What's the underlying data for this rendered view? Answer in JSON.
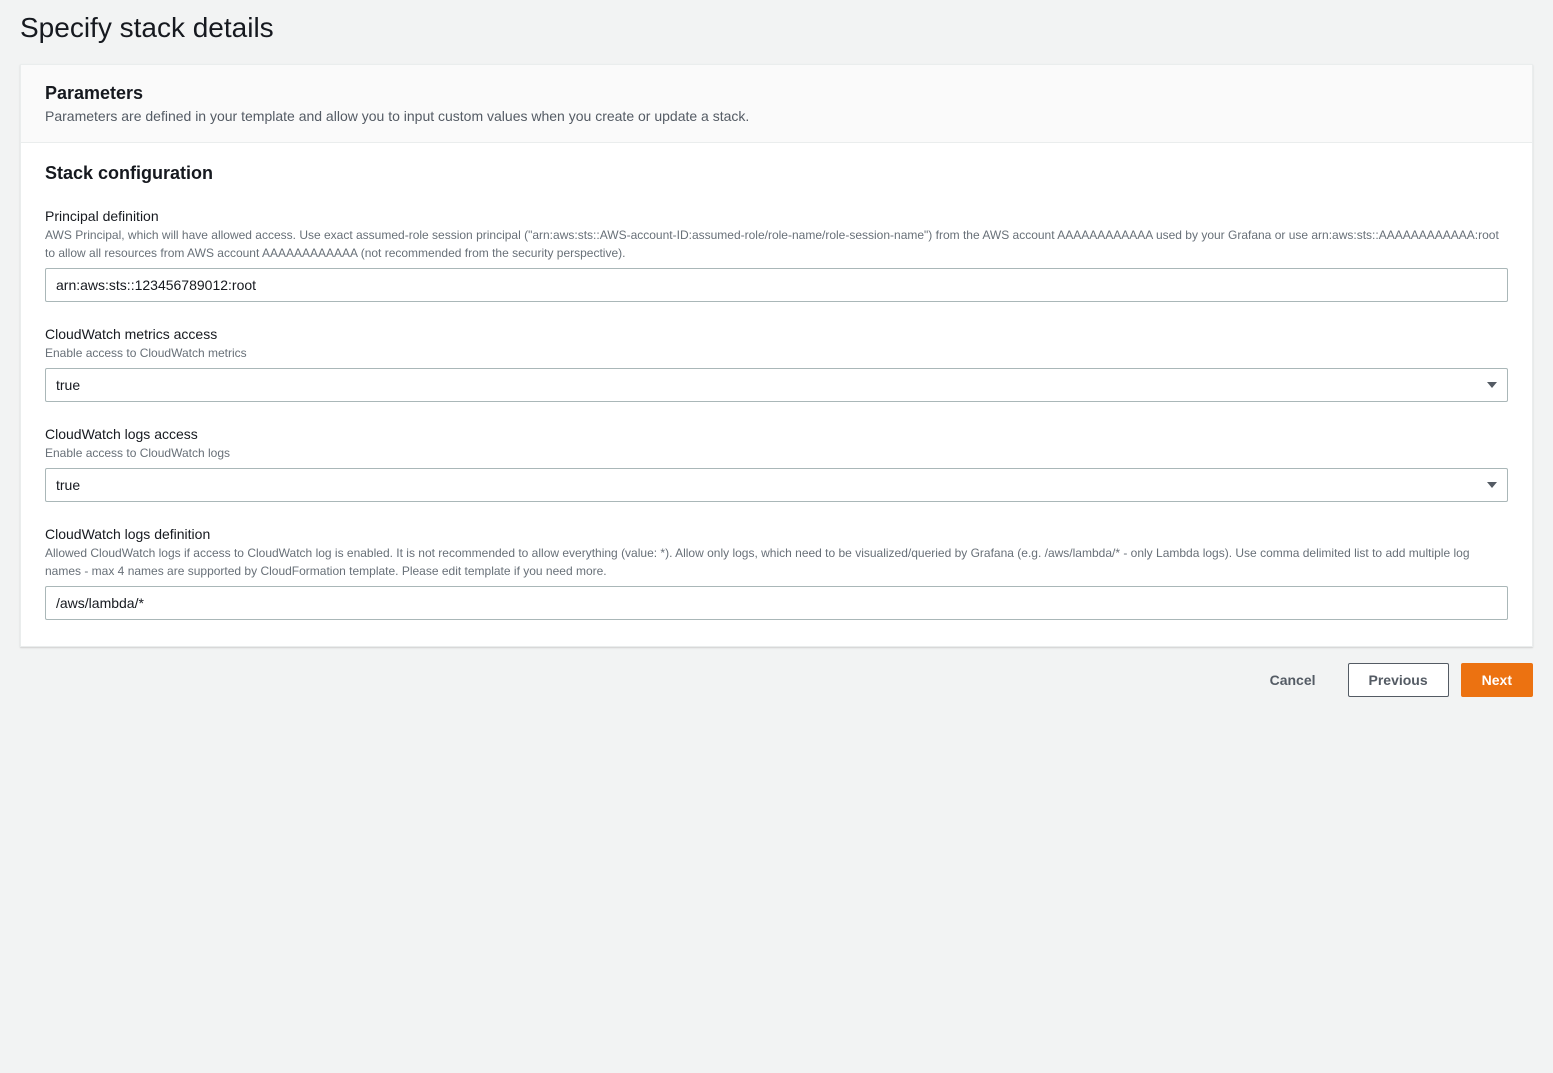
{
  "page": {
    "title": "Specify stack details"
  },
  "parameters_panel": {
    "heading": "Parameters",
    "description": "Parameters are defined in your template and allow you to input custom values when you create or update a stack."
  },
  "stack_config": {
    "heading": "Stack configuration",
    "fields": {
      "principal": {
        "label": "Principal definition",
        "description": "AWS Principal, which will have allowed access. Use exact assumed-role session principal (\"arn:aws:sts::AWS-account-ID:assumed-role/role-name/role-session-name\") from the AWS account AAAAAAAAAAAA used by your Grafana or use arn:aws:sts::AAAAAAAAAAAA:root to allow all resources from AWS account AAAAAAAAAAAA (not recommended from the security perspective).",
        "value": "arn:aws:sts::123456789012:root"
      },
      "metrics_access": {
        "label": "CloudWatch metrics access",
        "description": "Enable access to CloudWatch metrics",
        "value": "true"
      },
      "logs_access": {
        "label": "CloudWatch logs access",
        "description": "Enable access to CloudWatch logs",
        "value": "true"
      },
      "logs_definition": {
        "label": "CloudWatch logs definition",
        "description": "Allowed CloudWatch logs if access to CloudWatch log is enabled. It is not recommended to allow everything (value: *). Allow only logs, which need to be visualized/queried by Grafana (e.g. /aws/lambda/* - only Lambda logs). Use comma delimited list to add multiple log names - max 4 names are supported by CloudFormation template. Please edit template if you need more.",
        "value": "/aws/lambda/*"
      }
    }
  },
  "actions": {
    "cancel": "Cancel",
    "previous": "Previous",
    "next": "Next"
  }
}
